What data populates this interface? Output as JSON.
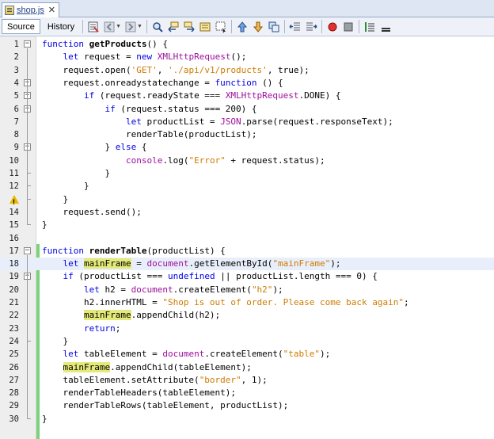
{
  "tab": {
    "title": "shop.js",
    "close": "✕"
  },
  "toolbar": {
    "source_label": "Source",
    "history_label": "History",
    "buttons": [
      "last-edit-icon",
      "back-icon",
      "forward-icon",
      "find-selection-icon",
      "find-previous-icon",
      "find-next-icon",
      "toggle-highlight-icon",
      "toggle-rect-select-icon",
      "previous-bookmark-icon",
      "next-bookmark-icon",
      "toggle-bookmark-icon",
      "shift-left-icon",
      "shift-right-icon",
      "start-macro-icon",
      "stop-macro-icon",
      "comment-icon",
      "uncomment-icon"
    ]
  },
  "code": {
    "lines": [
      {
        "n": "1",
        "t": "function getProducts() {"
      },
      {
        "n": "2",
        "t": "    let request = new XMLHttpRequest();"
      },
      {
        "n": "3",
        "t": "    request.open('GET', './api/v1/products', true);"
      },
      {
        "n": "4",
        "t": "    request.onreadystatechange = function () {"
      },
      {
        "n": "5",
        "t": "        if (request.readyState === XMLHttpRequest.DONE) {"
      },
      {
        "n": "6",
        "t": "            if (request.status === 200) {"
      },
      {
        "n": "7",
        "t": "                let productList = JSON.parse(request.responseText);"
      },
      {
        "n": "8",
        "t": "                renderTable(productList);"
      },
      {
        "n": "9",
        "t": "            } else {"
      },
      {
        "n": "10",
        "t": "                console.log(\"Error\" + request.status);"
      },
      {
        "n": "11",
        "t": "            }"
      },
      {
        "n": "12",
        "t": "        }"
      },
      {
        "n": "13",
        "t": "    }"
      },
      {
        "n": "14",
        "t": "    request.send();"
      },
      {
        "n": "15",
        "t": "}"
      },
      {
        "n": "16",
        "t": ""
      },
      {
        "n": "17",
        "t": "function renderTable(productList) {"
      },
      {
        "n": "18",
        "t": "    let mainFrame = document.getElementById(\"mainFrame\");"
      },
      {
        "n": "19",
        "t": "    if (productList === undefined || productList.length === 0) {"
      },
      {
        "n": "20",
        "t": "        let h2 = document.createElement(\"h2\");"
      },
      {
        "n": "21",
        "t": "        h2.innerHTML = \"Shop is out of order. Please come back again\";"
      },
      {
        "n": "22",
        "t": "        mainFrame.appendChild(h2);"
      },
      {
        "n": "23",
        "t": "        return;"
      },
      {
        "n": "24",
        "t": "    }"
      },
      {
        "n": "25",
        "t": "    let tableElement = document.createElement(\"table\");"
      },
      {
        "n": "26",
        "t": "    mainFrame.appendChild(tableElement);"
      },
      {
        "n": "27",
        "t": "    tableElement.setAttribute(\"border\", 1);"
      },
      {
        "n": "28",
        "t": "    renderTableHeaders(tableElement);"
      },
      {
        "n": "29",
        "t": "    renderTableRows(tableElement, productList);"
      },
      {
        "n": "30",
        "t": "}"
      }
    ],
    "highlighted_line": "18",
    "warning_line": "13",
    "fold_markers": [
      "1",
      "4",
      "5",
      "6",
      "9",
      "17",
      "19"
    ]
  },
  "colors": {
    "keyword": "#0000e6",
    "string": "#ce7b00",
    "global": "#9c0f9c",
    "occurrence_mark": "#e4ea7a",
    "current_line": "#e9effa",
    "change_bar": "#7ad37a"
  }
}
